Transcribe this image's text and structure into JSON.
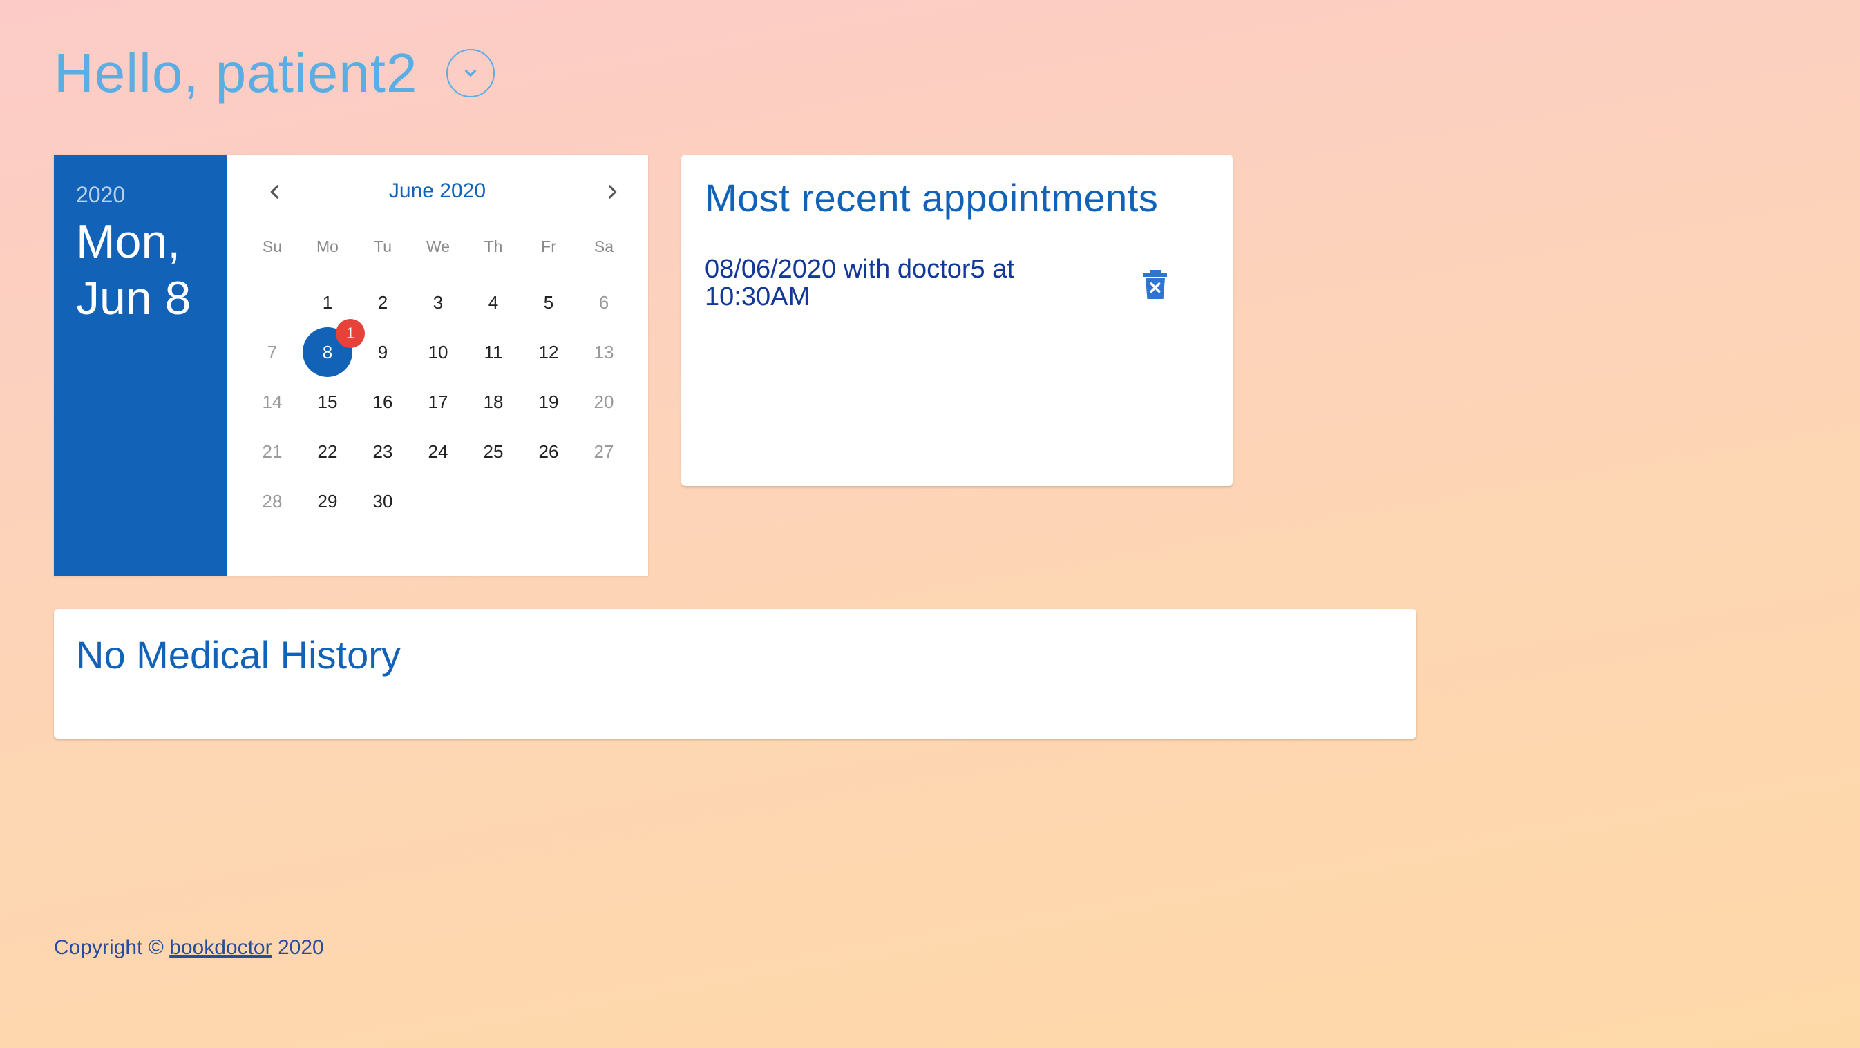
{
  "greeting": {
    "text": "Hello, patient2",
    "toggle_icon": "chevron-down-icon"
  },
  "calendar": {
    "side": {
      "year": "2020",
      "date": "Mon, Jun 8"
    },
    "header": {
      "month": "June 2020",
      "prev_icon": "chevron-left-icon",
      "next_icon": "chevron-right-icon"
    },
    "weekdays": [
      "Su",
      "Mo",
      "Tu",
      "We",
      "Th",
      "Fr",
      "Sa"
    ],
    "weeks": [
      [
        "",
        "1",
        "2",
        "3",
        "4",
        "5",
        "6"
      ],
      [
        "7",
        "8",
        "9",
        "10",
        "11",
        "12",
        "13"
      ],
      [
        "14",
        "15",
        "16",
        "17",
        "18",
        "19",
        "20"
      ],
      [
        "21",
        "22",
        "23",
        "24",
        "25",
        "26",
        "27"
      ],
      [
        "28",
        "29",
        "30",
        "",
        "",
        "",
        ""
      ]
    ],
    "selected_day": "8",
    "selected_badge": "1"
  },
  "appointments": {
    "title": "Most recent appointments",
    "items": [
      {
        "text": "08/06/2020 with doctor5 at 10:30AM",
        "delete_icon": "trash-icon"
      }
    ]
  },
  "history": {
    "title": "No Medical History"
  },
  "footer": {
    "prefix": "Copyright © ",
    "link": "bookdoctor",
    "suffix": " 2020"
  },
  "colors": {
    "primary": "#1262b8",
    "greeting": "#5aaee3",
    "badge": "#e8413a"
  }
}
